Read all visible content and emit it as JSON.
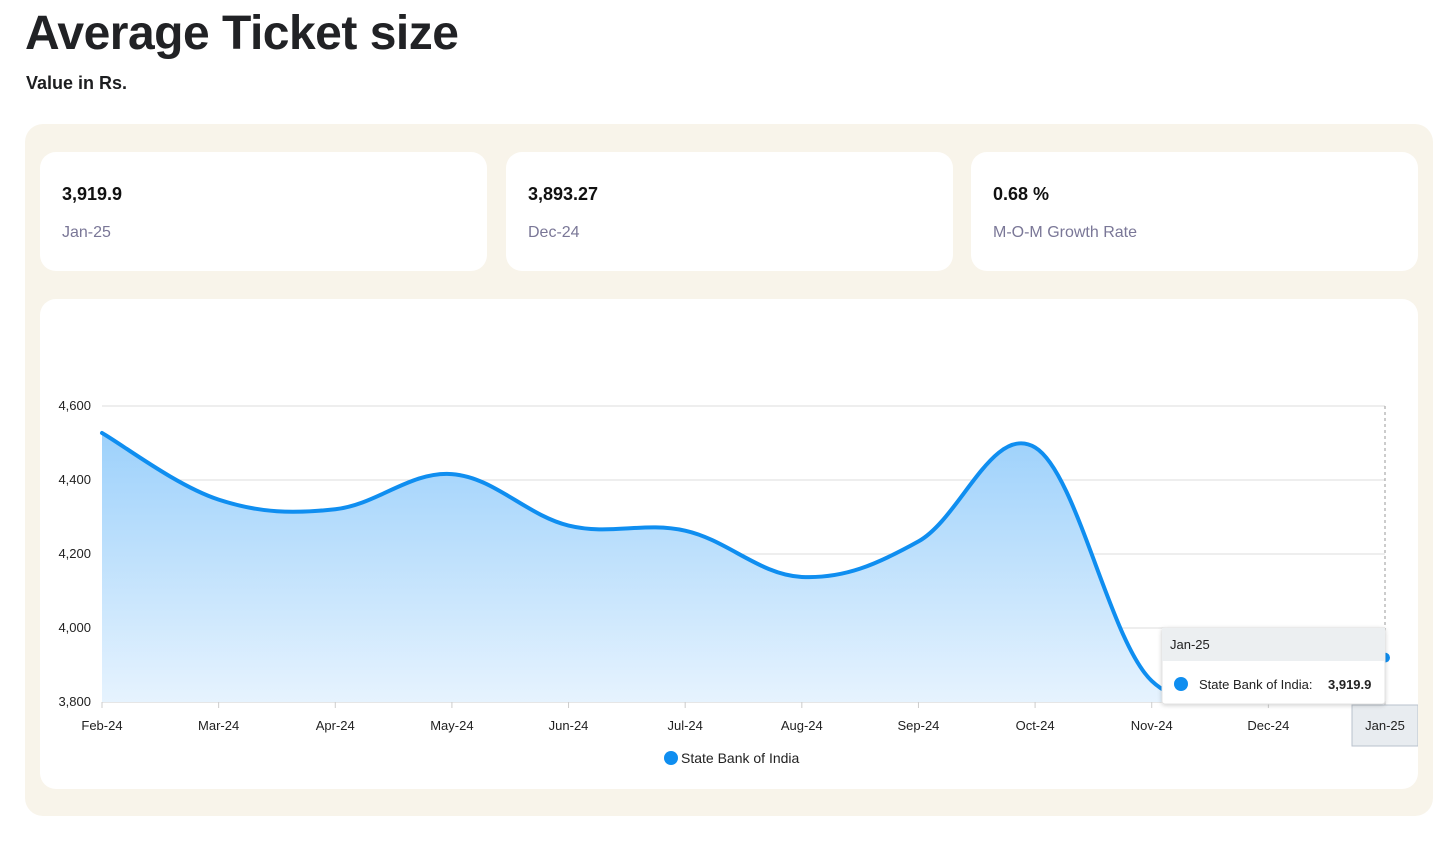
{
  "header": {
    "title": "Average Ticket size",
    "subtitle": "Value in Rs."
  },
  "stats": [
    {
      "value": "3,919.9",
      "label": "Jan-25"
    },
    {
      "value": "3,893.27",
      "label": "Dec-24"
    },
    {
      "value": "0.68 %",
      "label": "M-O-M Growth Rate"
    }
  ],
  "colors": {
    "series": "#0f8ef0",
    "area_top": "#9dd1fb",
    "area_bottom": "#e6f3fe",
    "panel": "#f8f4ea"
  },
  "chart_data": {
    "type": "area",
    "x": [
      "Feb-24",
      "Mar-24",
      "Apr-24",
      "May-24",
      "Jun-24",
      "Jul-24",
      "Aug-24",
      "Sep-24",
      "Oct-24",
      "Nov-24",
      "Dec-24",
      "Jan-25"
    ],
    "series": [
      {
        "name": "State Bank of India",
        "values": [
          4527,
          4347,
          4321,
          4416,
          4277,
          4263,
          4138,
          4234,
          4488,
          3857,
          3893.27,
          3919.9
        ]
      }
    ],
    "yticks": [
      "4,600",
      "4,400",
      "4,200",
      "4,000",
      "3,800"
    ],
    "ylim": [
      3800,
      4600
    ],
    "grid": true,
    "legend": "bottom-center",
    "tooltip": {
      "title": "Jan-25",
      "series_label": "State Bank of India:",
      "value": "3,919.9"
    }
  }
}
